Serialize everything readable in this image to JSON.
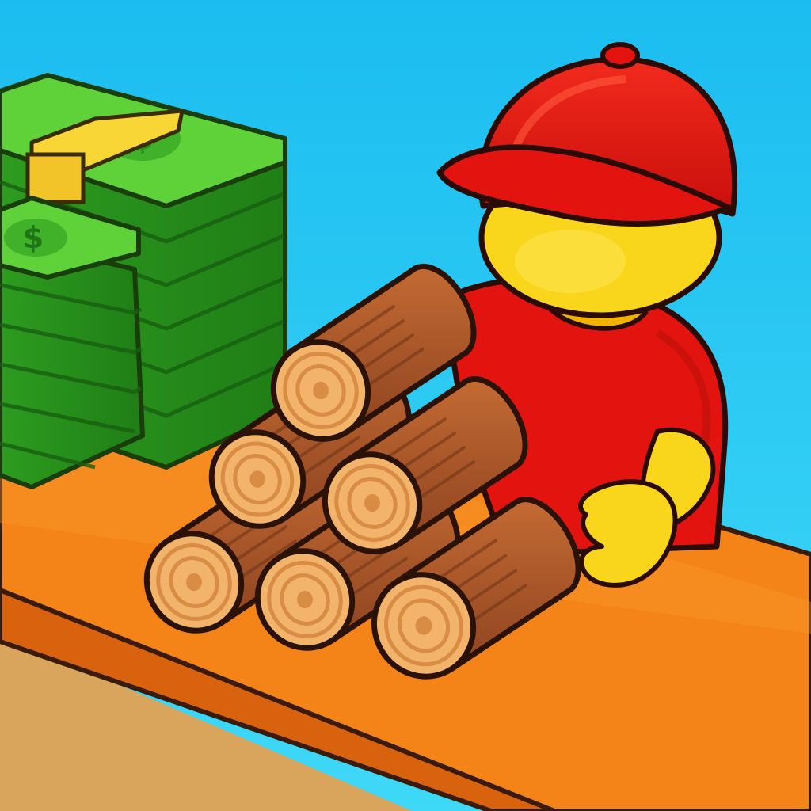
{
  "scene": {
    "kind": "game-icon",
    "colors": {
      "sky": "#22c8f2",
      "counter_top": "#f58418",
      "counter_front": "#d65d10",
      "floor": "#d9a45c",
      "cash_green": "#2f9e22",
      "cash_band": "#f7d636",
      "cap": "#e3140f",
      "shirt": "#e3140f",
      "skin": "#f9d61b",
      "log_bark": "#a9562a",
      "log_end": "#f2b36a"
    },
    "cash_stacks": [
      {
        "symbol": "$"
      },
      {
        "symbol": "$"
      }
    ],
    "logs_count": 6,
    "character": {
      "cap_icon": "baseball-cap-icon",
      "role": "worker"
    }
  }
}
